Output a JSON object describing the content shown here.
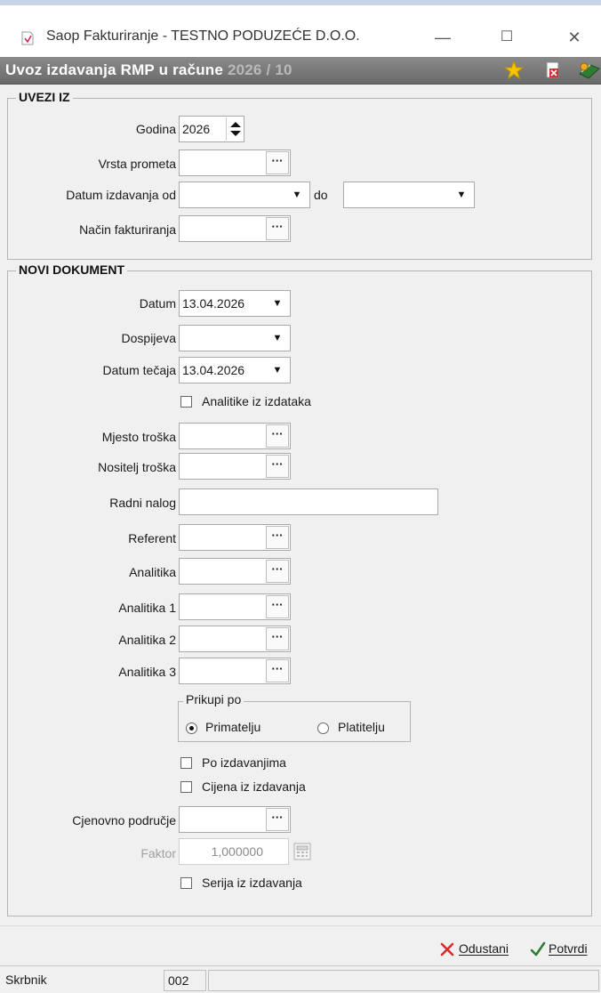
{
  "window": {
    "title": "Saop Fakturiranje - TESTNO PODUZEĆE D.O.O.",
    "form_title_main": "Uvoz izdavanja RMP u račune ",
    "form_title_faded": "2026 / 10"
  },
  "uvezi_iz": {
    "group_title": "UVEZI IZ",
    "godina_label": "Godina",
    "godina_value": "2026",
    "vrsta_prometa_label": "Vrsta prometa",
    "datum_izdavanja_label": "Datum izdavanja od",
    "do_label": "do",
    "nacin_fakturiranja_label": "Način fakturiranja"
  },
  "novi_dokument": {
    "group_title": "NOVI DOKUMENT",
    "datum_label": "Datum",
    "datum_value": "13.04.2026",
    "dospijeva_label": "Dospijeva",
    "datum_tecaja_label": "Datum tečaja",
    "datum_tecaja_value": "13.04.2026",
    "analitike_label": "Analitike iz izdataka",
    "mjesto_troska_label": "Mjesto troška",
    "nositelj_troska_label": "Nositelj troška",
    "radni_nalog_label": "Radni nalog",
    "referent_label": "Referent",
    "analitika_label": "Analitika",
    "analitika1_label": "Analitika 1",
    "analitika2_label": "Analitika 2",
    "analitika3_label": "Analitika 3",
    "prikupi_po_title": "Prikupi po",
    "primatelju_label": "Primatelju",
    "platitelju_label": "Platitelju",
    "prikupi_po_selected": "Primatelju",
    "po_izdavanjima_label": "Po izdavanjima",
    "cijena_label": "Cijena iz izdavanja",
    "cjenovno_label": "Cjenovno područje",
    "faktor_label": "Faktor",
    "faktor_value": "1,000000",
    "serija_label": "Serija iz izdavanja"
  },
  "buttons": {
    "dots": "···",
    "odustani": "Odustani",
    "potvrdi": "Potvrdi"
  },
  "statusbar": {
    "user": "Skrbnik",
    "code": "002"
  }
}
